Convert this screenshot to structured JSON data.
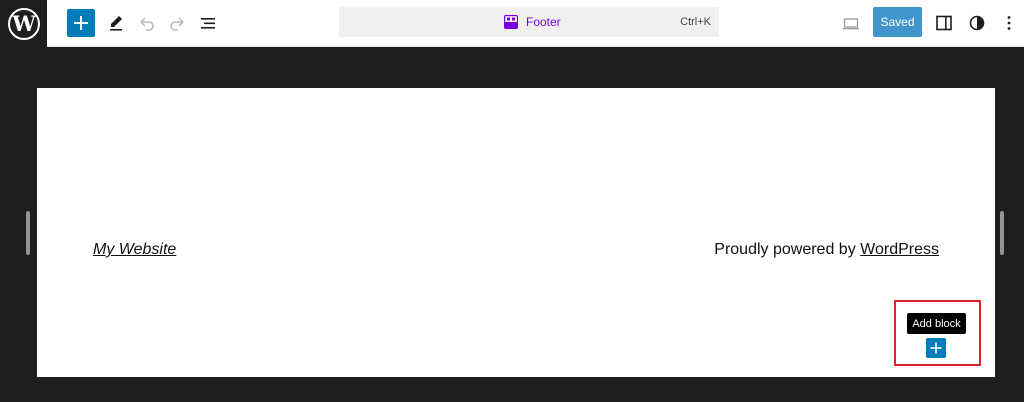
{
  "toolbar": {
    "logo_icon": "wordpress-logo-icon",
    "add_icon": "plus-icon",
    "tools_icon": "pencil-icon",
    "undo_icon": "undo-icon",
    "redo_icon": "redo-icon",
    "list_view_icon": "list-view-icon",
    "document_title": "Footer",
    "document_icon": "template-part-icon",
    "shortcut": "Ctrl+K",
    "preview_icon": "desktop-icon",
    "save_label": "Saved",
    "settings_icon": "sidebar-icon",
    "styles_icon": "half-circle-icon",
    "options_icon": "more-vertical-icon",
    "accent_color": "#007cba",
    "document_color": "#7a00df"
  },
  "canvas": {
    "site_title": "My Website",
    "credit_prefix": "Proudly powered by",
    "credit_link": "WordPress",
    "tooltip": "Add block",
    "inserter_icon": "plus-icon",
    "highlight_color": "#e0202b"
  }
}
